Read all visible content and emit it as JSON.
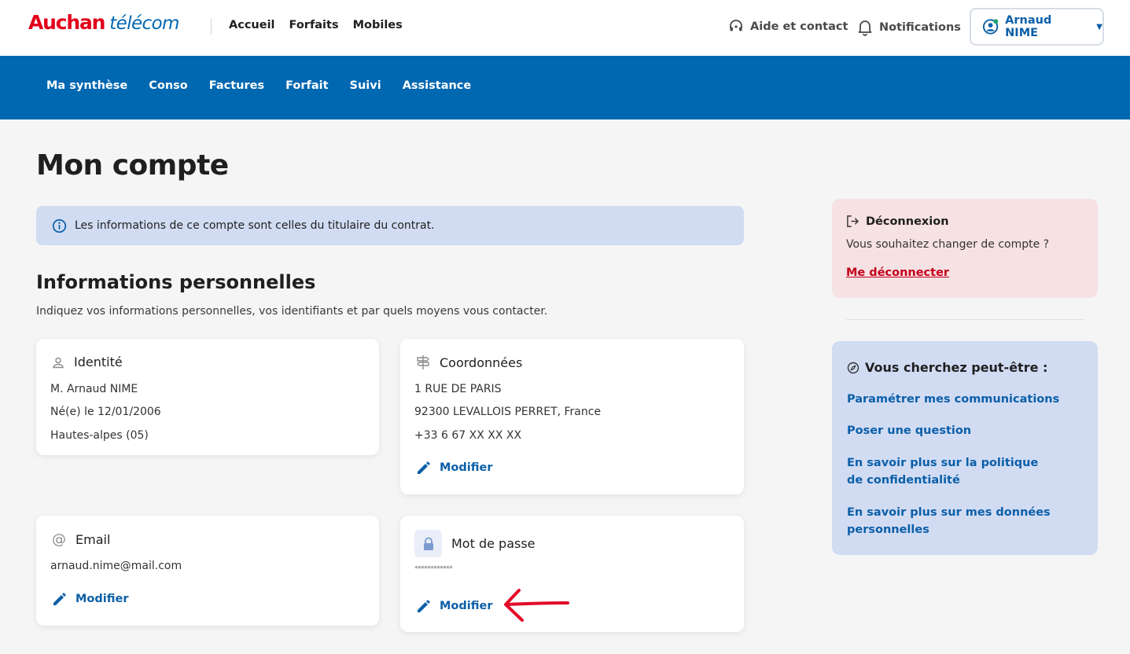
{
  "header": {
    "logo_brand": "Auchan",
    "logo_product": "télécom",
    "nav": [
      "Accueil",
      "Forfaits",
      "Mobiles"
    ],
    "help": "Aide et contact",
    "notifications": "Notifications",
    "account_name": "Arnaud NIME"
  },
  "subnav": [
    "Ma synthèse",
    "Conso",
    "Factures",
    "Forfait",
    "Suivi",
    "Assistance"
  ],
  "main": {
    "title": "Mon compte",
    "banner": "Les informations de ce compte sont celles du titulaire du contrat.",
    "section_title": "Informations personnelles",
    "section_subtitle": "Indiquez vos informations personnelles, vos identifiants et par quels moyens vous contacter.",
    "identity": {
      "title": "Identité",
      "lines": [
        "M. Arnaud NIME",
        "Né(e) le 12/01/2006",
        "Hautes-alpes (05)"
      ]
    },
    "contact": {
      "title": "Coordonnées",
      "lines": [
        "1 RUE DE PARIS",
        "92300 LEVALLOIS PERRET, France",
        "+33 6 67 XX XX XX"
      ],
      "action": "Modifier"
    },
    "email": {
      "title": "Email",
      "value": "arnaud.nime@mail.com",
      "action": "Modifier"
    },
    "password": {
      "title": "Mot de passe",
      "value": "************",
      "action": "Modifier"
    }
  },
  "sidebar": {
    "logout": {
      "title": "Déconnexion",
      "text": "Vous souhaitez changer de compte ?",
      "link": "Me déconnecter"
    },
    "suggest": {
      "title": "Vous cherchez peut-être :",
      "links": [
        "Paramétrer mes communications",
        "Poser une question",
        "En savoir plus sur la politique de confidentialité",
        "En savoir plus sur mes données personnelles"
      ]
    }
  },
  "colors": {
    "brand_red": "#e2001a",
    "brand_blue": "#0067b1",
    "link_blue": "#0c5fa8",
    "banner_bg": "#d1dcf3",
    "logout_bg": "#f6e1e3",
    "arrow_red": "#e30b2a"
  }
}
